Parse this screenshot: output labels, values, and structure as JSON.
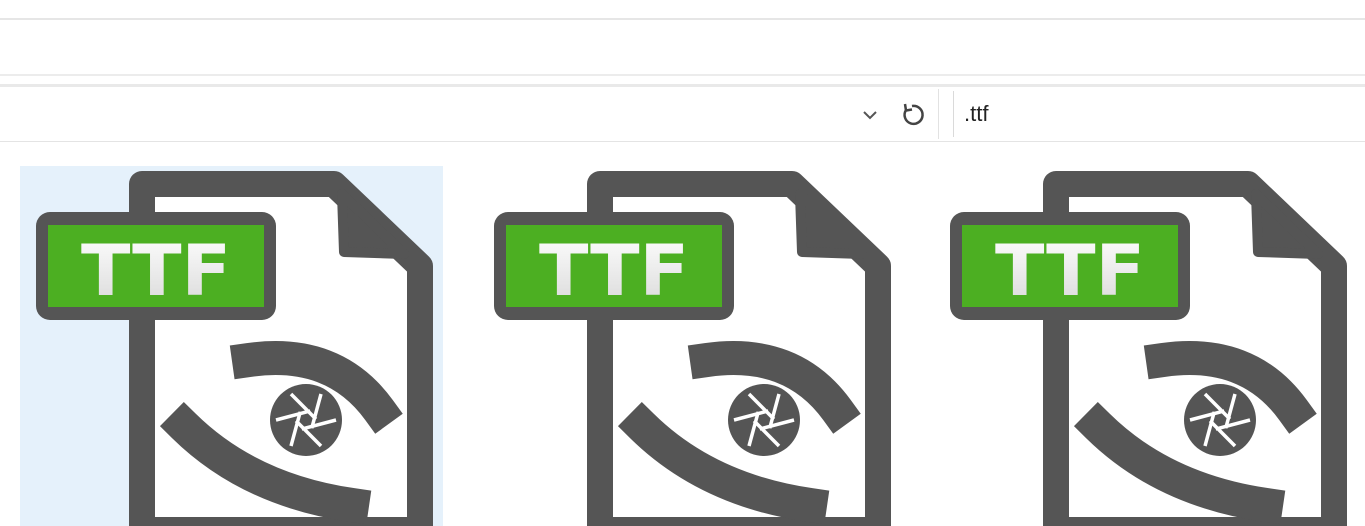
{
  "toolbar": {
    "dropdown_icon": "chevron-down-icon",
    "refresh_icon": "refresh-icon",
    "search_value": ".ttf"
  },
  "files": [
    {
      "badge_text": "TTF",
      "icon": "ttf-file-icon",
      "selected": true
    },
    {
      "badge_text": "TTF",
      "icon": "ttf-file-icon",
      "selected": false
    },
    {
      "badge_text": "TTF",
      "icon": "ttf-file-icon",
      "selected": false
    }
  ],
  "colors": {
    "badge_green": "#4caf22",
    "icon_dark": "#555555",
    "selection": "#e5f1fb"
  }
}
